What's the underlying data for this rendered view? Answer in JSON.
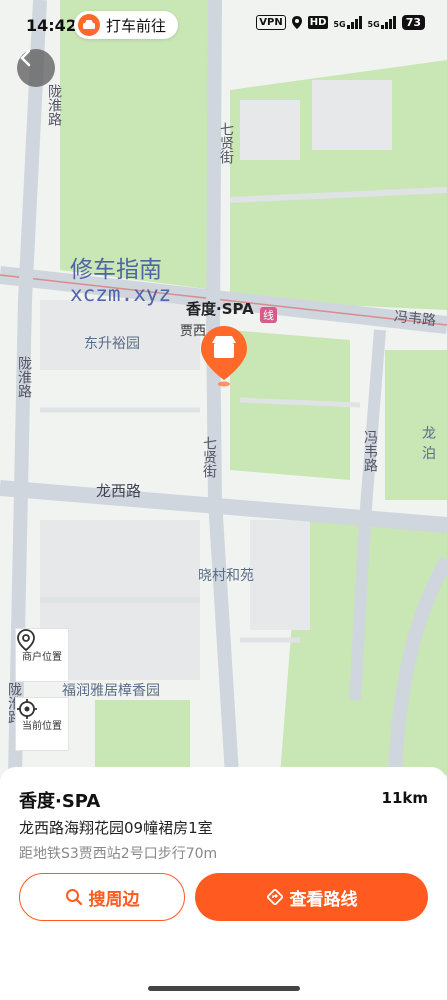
{
  "status": {
    "time": "14:42",
    "vpn": "VPN",
    "hd": "HD",
    "signal1": "5G",
    "signal2": "5G",
    "battery": "73"
  },
  "taxi_chip": {
    "label": "打车前往"
  },
  "map": {
    "roads": {
      "longxi_road": "龙西路",
      "qixian_street_top": "七贤街",
      "qixian_street_bottom": "七贤街",
      "fengwei_road_upper": "冯韦路",
      "fengwei_road_lower": "冯韦路",
      "longhuai_road_upper": "陇淮路",
      "longhuai_road_middle": "陇淮路",
      "longhuai_road_lower": "陇淮路"
    },
    "places": {
      "dongsheng": "东升裕园",
      "xiaocun": "晓村和苑",
      "furun": "福润雅居樟香园",
      "jiaxi_partial": "贾西",
      "line_badge": "线",
      "long_partial": "龙泊"
    },
    "watermark": {
      "line1": "修车指南",
      "line2": "xczm.xyz"
    },
    "pin_label": "香度·SPA",
    "buttons": {
      "merchant_location": "商户位置",
      "current_location": "当前位置"
    }
  },
  "poi": {
    "name": "香度·SPA",
    "distance": "11km",
    "address": "龙西路海翔花园09幢裙房1室",
    "metro": "距地铁S3贾西站2号口步行70m"
  },
  "actions": {
    "search_around": "搜周边",
    "view_route": "查看路线"
  },
  "colors": {
    "accent": "#ff5a1f",
    "green_area": "#c8e6b4",
    "road": "#cfd6dd"
  }
}
